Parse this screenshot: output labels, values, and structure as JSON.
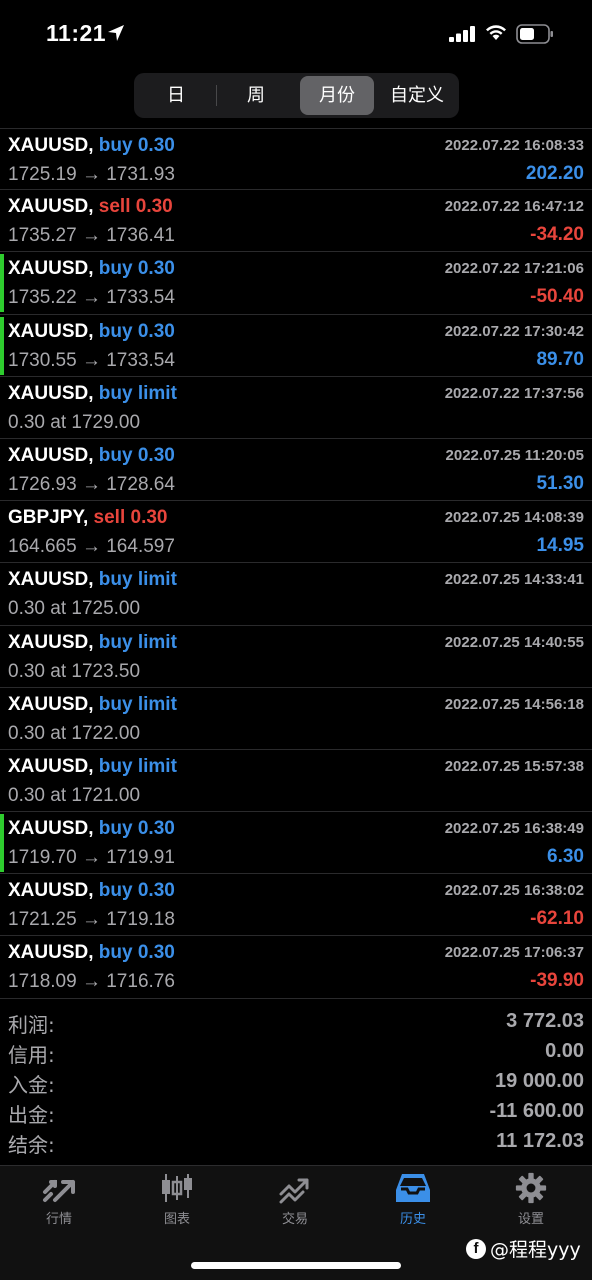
{
  "status_bar": {
    "time": "11:21"
  },
  "tabs_period": [
    {
      "label": "日",
      "active": false
    },
    {
      "label": "周",
      "active": false
    },
    {
      "label": "月份",
      "active": true
    },
    {
      "label": "自定义",
      "active": false
    }
  ],
  "trades": [
    {
      "symbol": "XAUUSD,",
      "type": "buy 0.30",
      "side": "buy",
      "date": "2022.07.22 16:08:33",
      "detail": "1725.19 → 1731.93",
      "profit": "202.20",
      "marked": false
    },
    {
      "symbol": "XAUUSD,",
      "type": "sell 0.30",
      "side": "sell",
      "date": "2022.07.22 16:47:12",
      "detail": "1735.27 → 1736.41",
      "profit": "-34.20",
      "marked": false
    },
    {
      "symbol": "XAUUSD,",
      "type": "buy 0.30",
      "side": "buy",
      "date": "2022.07.22 17:21:06",
      "detail": "1735.22 → 1733.54",
      "profit": "-50.40",
      "marked": true
    },
    {
      "symbol": "XAUUSD,",
      "type": "buy 0.30",
      "side": "buy",
      "date": "2022.07.22 17:30:42",
      "detail": "1730.55 → 1733.54",
      "profit": "89.70",
      "marked": true
    },
    {
      "symbol": "XAUUSD,",
      "type": "buy limit",
      "side": "buy",
      "date": "2022.07.22 17:37:56",
      "detail": "0.30 at 1729.00",
      "profit": "",
      "marked": false
    },
    {
      "symbol": "XAUUSD,",
      "type": "buy 0.30",
      "side": "buy",
      "date": "2022.07.25 11:20:05",
      "detail": "1726.93 → 1728.64",
      "profit": "51.30",
      "marked": false
    },
    {
      "symbol": "GBPJPY,",
      "type": "sell 0.30",
      "side": "sell",
      "date": "2022.07.25 14:08:39",
      "detail": "164.665 → 164.597",
      "profit": "14.95",
      "marked": false
    },
    {
      "symbol": "XAUUSD,",
      "type": "buy limit",
      "side": "buy",
      "date": "2022.07.25 14:33:41",
      "detail": "0.30 at 1725.00",
      "profit": "",
      "marked": false
    },
    {
      "symbol": "XAUUSD,",
      "type": "buy limit",
      "side": "buy",
      "date": "2022.07.25 14:40:55",
      "detail": "0.30 at 1723.50",
      "profit": "",
      "marked": false
    },
    {
      "symbol": "XAUUSD,",
      "type": "buy limit",
      "side": "buy",
      "date": "2022.07.25 14:56:18",
      "detail": "0.30 at 1722.00",
      "profit": "",
      "marked": false
    },
    {
      "symbol": "XAUUSD,",
      "type": "buy limit",
      "side": "buy",
      "date": "2022.07.25 15:57:38",
      "detail": "0.30 at 1721.00",
      "profit": "",
      "marked": false
    },
    {
      "symbol": "XAUUSD,",
      "type": "buy 0.30",
      "side": "buy",
      "date": "2022.07.25 16:38:49",
      "detail": "1719.70 → 1719.91",
      "profit": "6.30",
      "marked": true
    },
    {
      "symbol": "XAUUSD,",
      "type": "buy 0.30",
      "side": "buy",
      "date": "2022.07.25 16:38:02",
      "detail": "1721.25 → 1719.18",
      "profit": "-62.10",
      "marked": false
    },
    {
      "symbol": "XAUUSD,",
      "type": "buy 0.30",
      "side": "buy",
      "date": "2022.07.25 17:06:37",
      "detail": "1718.09 → 1716.76",
      "profit": "-39.90",
      "marked": false
    }
  ],
  "summary": [
    {
      "label": "利润:",
      "value": "3 772.03"
    },
    {
      "label": "信用:",
      "value": "0.00"
    },
    {
      "label": "入金:",
      "value": "19 000.00"
    },
    {
      "label": "出金:",
      "value": "-11 600.00"
    },
    {
      "label": "结余:",
      "value": "11 172.03"
    }
  ],
  "bottom_tabs": [
    {
      "label": "行情",
      "icon": "quotes-icon",
      "active": false
    },
    {
      "label": "图表",
      "icon": "chart-icon",
      "active": false
    },
    {
      "label": "交易",
      "icon": "trade-icon",
      "active": false
    },
    {
      "label": "历史",
      "icon": "history-icon",
      "active": true
    },
    {
      "label": "设置",
      "icon": "gear-icon",
      "active": false
    }
  ],
  "watermark": "@程程yyy",
  "colors": {
    "buy": "#3b8fe8",
    "sell": "#e8453c",
    "marker": "#2ecc2e",
    "muted": "#a9a9ad"
  }
}
